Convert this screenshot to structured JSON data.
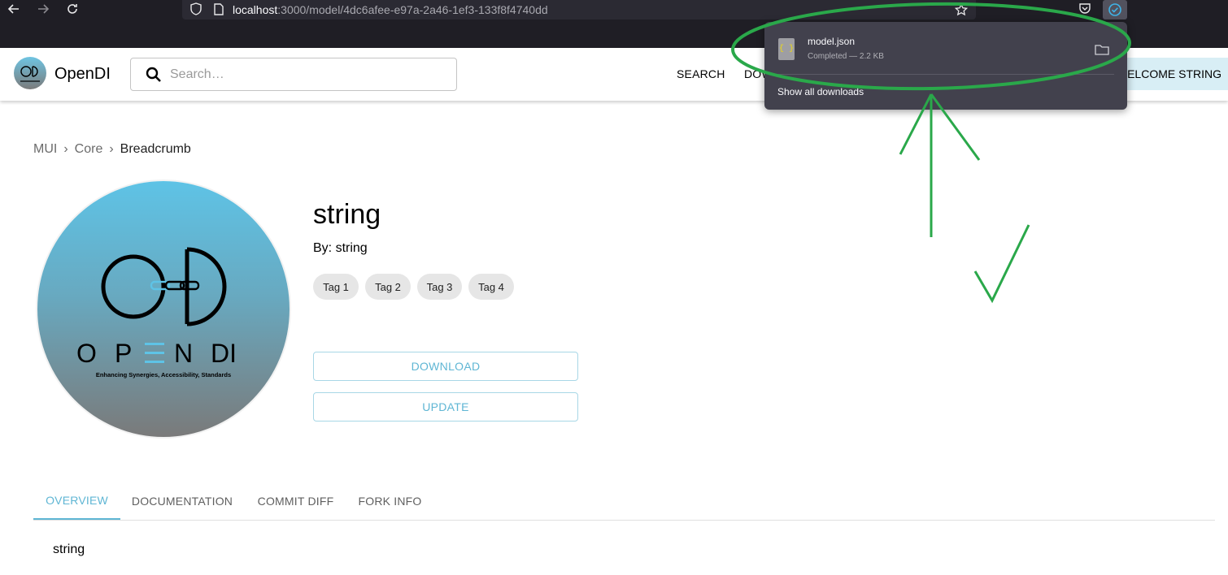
{
  "browser": {
    "url_host": "localhost",
    "url_path": ":3000/model/4dc6afee-e97a-2a46-1ef3-133f8f4740dd",
    "icons": [
      "back-arrow-icon",
      "forward-arrow-icon",
      "reload-icon",
      "shield-icon",
      "page-icon",
      "star-icon",
      "pocket-icon",
      "downloads-icon"
    ]
  },
  "downloads": {
    "filename": "model.json",
    "status": "Completed — 2.2 KB",
    "show_all": "Show all downloads",
    "file_icon_glyph": "{ }"
  },
  "header": {
    "title": "OpenDI",
    "search_placeholder": "Search…",
    "nav": {
      "search": "SEARCH",
      "download_partial": "DOW"
    },
    "welcome": "WELCOME STRING"
  },
  "breadcrumb": {
    "items": [
      "MUI",
      "Core",
      "Breadcrumb"
    ],
    "separator": "›"
  },
  "logo": {
    "wordmark_o": "O",
    "wordmark_p": "P",
    "wordmark_n": "N",
    "wordmark_di": "DI",
    "tagline": "Enhancing Synergies, Accessibility, Standards"
  },
  "model": {
    "name": "string",
    "author": "By: string",
    "tags": [
      "Tag 1",
      "Tag 2",
      "Tag 3",
      "Tag 4"
    ],
    "download_label": "DOWNLOAD",
    "update_label": "UPDATE"
  },
  "tabs": {
    "items": [
      "OVERVIEW",
      "DOCUMENTATION",
      "COMMIT DIFF",
      "FORK INFO"
    ],
    "active": "OVERVIEW",
    "content": "string"
  },
  "colors": {
    "accent": "#5fb6d4",
    "annotation": "#2aa84a",
    "browser_bg": "#1f1e25"
  }
}
